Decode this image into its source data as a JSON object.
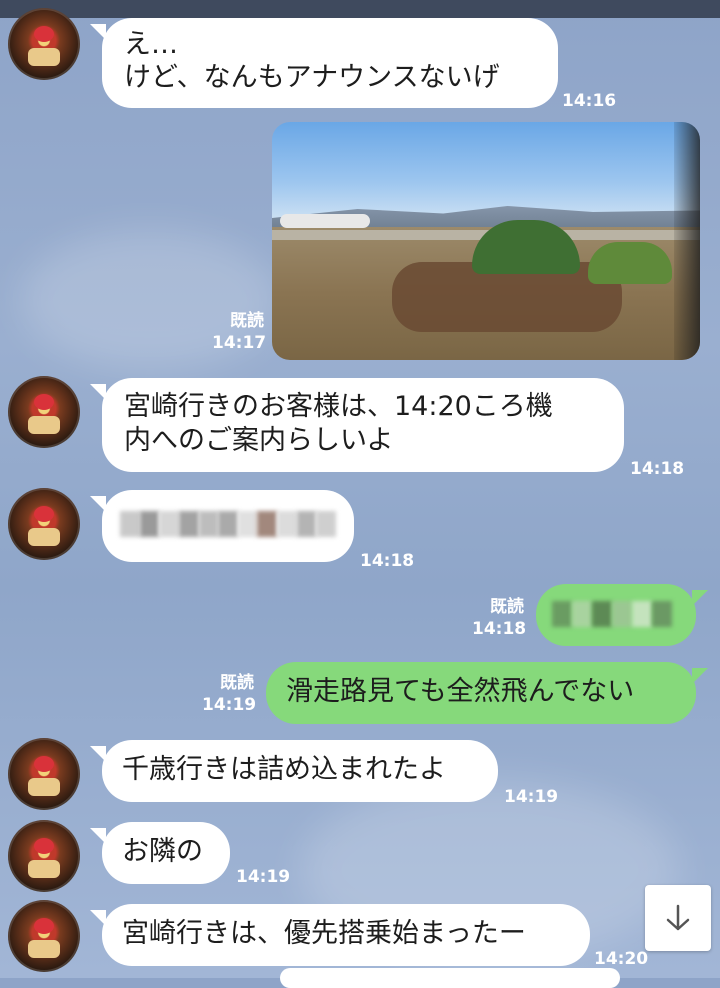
{
  "messages": [
    {
      "side": "in",
      "text": "え…\nけど、なんもアナウンスないげ",
      "time": "14:16"
    },
    {
      "side": "out",
      "type": "image",
      "read": "既読",
      "time": "14:17"
    },
    {
      "side": "in",
      "text": "宮崎行きのお客様は、14:20ころ機\n内へのご案内らしいよ",
      "time": "14:18"
    },
    {
      "side": "in",
      "type": "blurred",
      "time": "14:18"
    },
    {
      "side": "out",
      "type": "blurred",
      "read": "既読",
      "time": "14:18"
    },
    {
      "side": "out",
      "text": "滑走路見ても全然飛んでない",
      "read": "既読",
      "time": "14:19"
    },
    {
      "side": "in",
      "text": "千歳行きは詰め込まれたよ",
      "time": "14:19"
    },
    {
      "side": "in",
      "text": "お隣の",
      "time": "14:19"
    },
    {
      "side": "in",
      "text": "宮崎行きは、優先搭乗始まったー",
      "time": "14:20"
    }
  ],
  "icons": {
    "scroll_down": "arrow-down-icon"
  },
  "colors": {
    "incoming_bubble": "#ffffff",
    "outgoing_bubble": "#86d97b",
    "background": "#8fa6c9"
  }
}
